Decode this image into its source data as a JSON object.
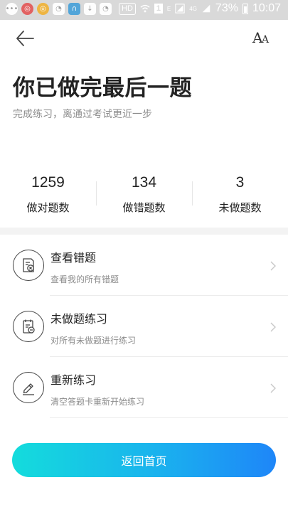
{
  "status_bar": {
    "hd_label": "HD",
    "sim_label": "1",
    "e_label": "E",
    "network_label": "4G",
    "battery_percent": "73%",
    "time": "10:07"
  },
  "header": {
    "title": "你已做完最后一题",
    "subtitle": "完成练习，离通过考试更近一步"
  },
  "font_button": {
    "big": "A",
    "small": "A"
  },
  "stats": [
    {
      "value": "1259",
      "label": "做对题数"
    },
    {
      "value": "134",
      "label": "做错题数"
    },
    {
      "value": "3",
      "label": "未做题数"
    }
  ],
  "options": [
    {
      "title": "查看错题",
      "desc": "查看我的所有错题",
      "icon": "wrong-questions-icon"
    },
    {
      "title": "未做题练习",
      "desc": "对所有未做题进行练习",
      "icon": "undone-practice-icon"
    },
    {
      "title": "重新练习",
      "desc": "清空答题卡重新开始练习",
      "icon": "pencil-icon"
    }
  ],
  "home_button": {
    "label": "返回首页"
  },
  "colors": {
    "gradient_start": "#14dcdc",
    "gradient_end": "#1e86f8",
    "title_text": "#222222",
    "secondary_text": "#8c8c8c"
  }
}
